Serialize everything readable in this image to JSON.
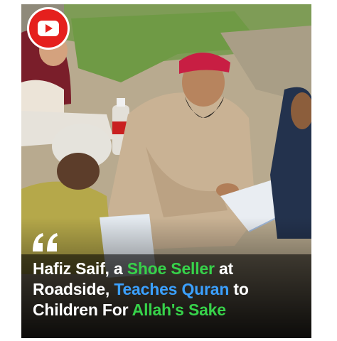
{
  "post": {
    "caption": {
      "part1": "Hafiz Saif, a ",
      "highlight1": "Shoe Seller",
      "part2": " at Roadside, ",
      "highlight2": "Teaches Quran",
      "part3": " to Children For ",
      "highlight3": "Allah's Sake"
    },
    "badge_icon": "youtube-play-icon",
    "quote_icon": "quote-icon",
    "colors": {
      "badge_red": "#e5201d",
      "highlight_green": "#37d24a",
      "highlight_blue": "#3ba0ff",
      "caption_text": "#ffffff"
    }
  }
}
